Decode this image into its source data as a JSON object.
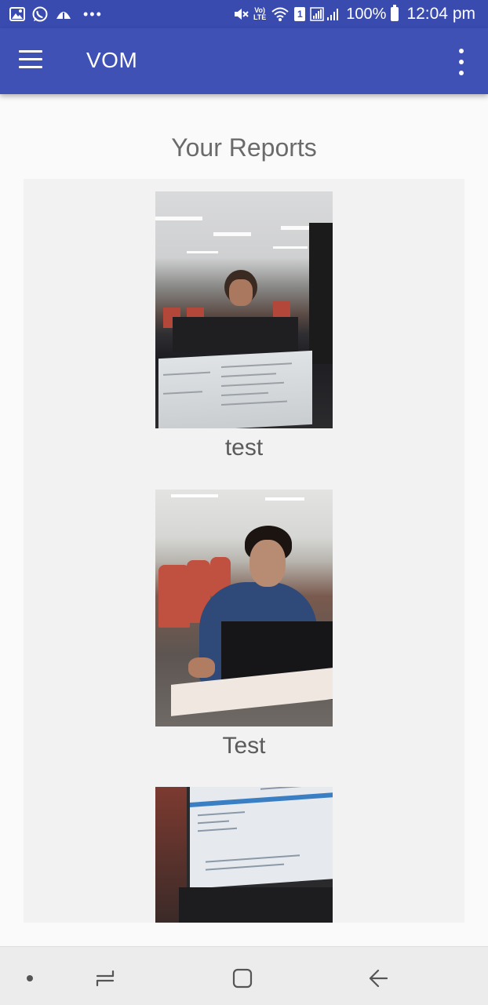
{
  "status_bar": {
    "volte_top": "Vo)",
    "volte_bottom": "LTE",
    "sim": "1",
    "battery": "100%",
    "time": "12:04 pm",
    "dots": "•••",
    "icons": [
      "gallery-icon",
      "whatsapp-icon",
      "weather-icon",
      "mute-icon",
      "wifi-icon",
      "signal-icon",
      "battery-icon"
    ]
  },
  "app_bar": {
    "title": "VOM",
    "icons": [
      "menu-icon",
      "overflow-menu-icon"
    ]
  },
  "main": {
    "title": "Your Reports",
    "reports": [
      {
        "label": "test"
      },
      {
        "label": "Test"
      },
      {
        "label": ""
      }
    ]
  },
  "nav_bar": {
    "icons": [
      "nav-dot-icon",
      "recents-icon",
      "home-icon",
      "back-icon"
    ]
  },
  "colors": {
    "app_bar": "#3f51b5",
    "status_bar": "#3a4bb0",
    "background": "#fafafa",
    "panel": "#f2f2f2"
  }
}
